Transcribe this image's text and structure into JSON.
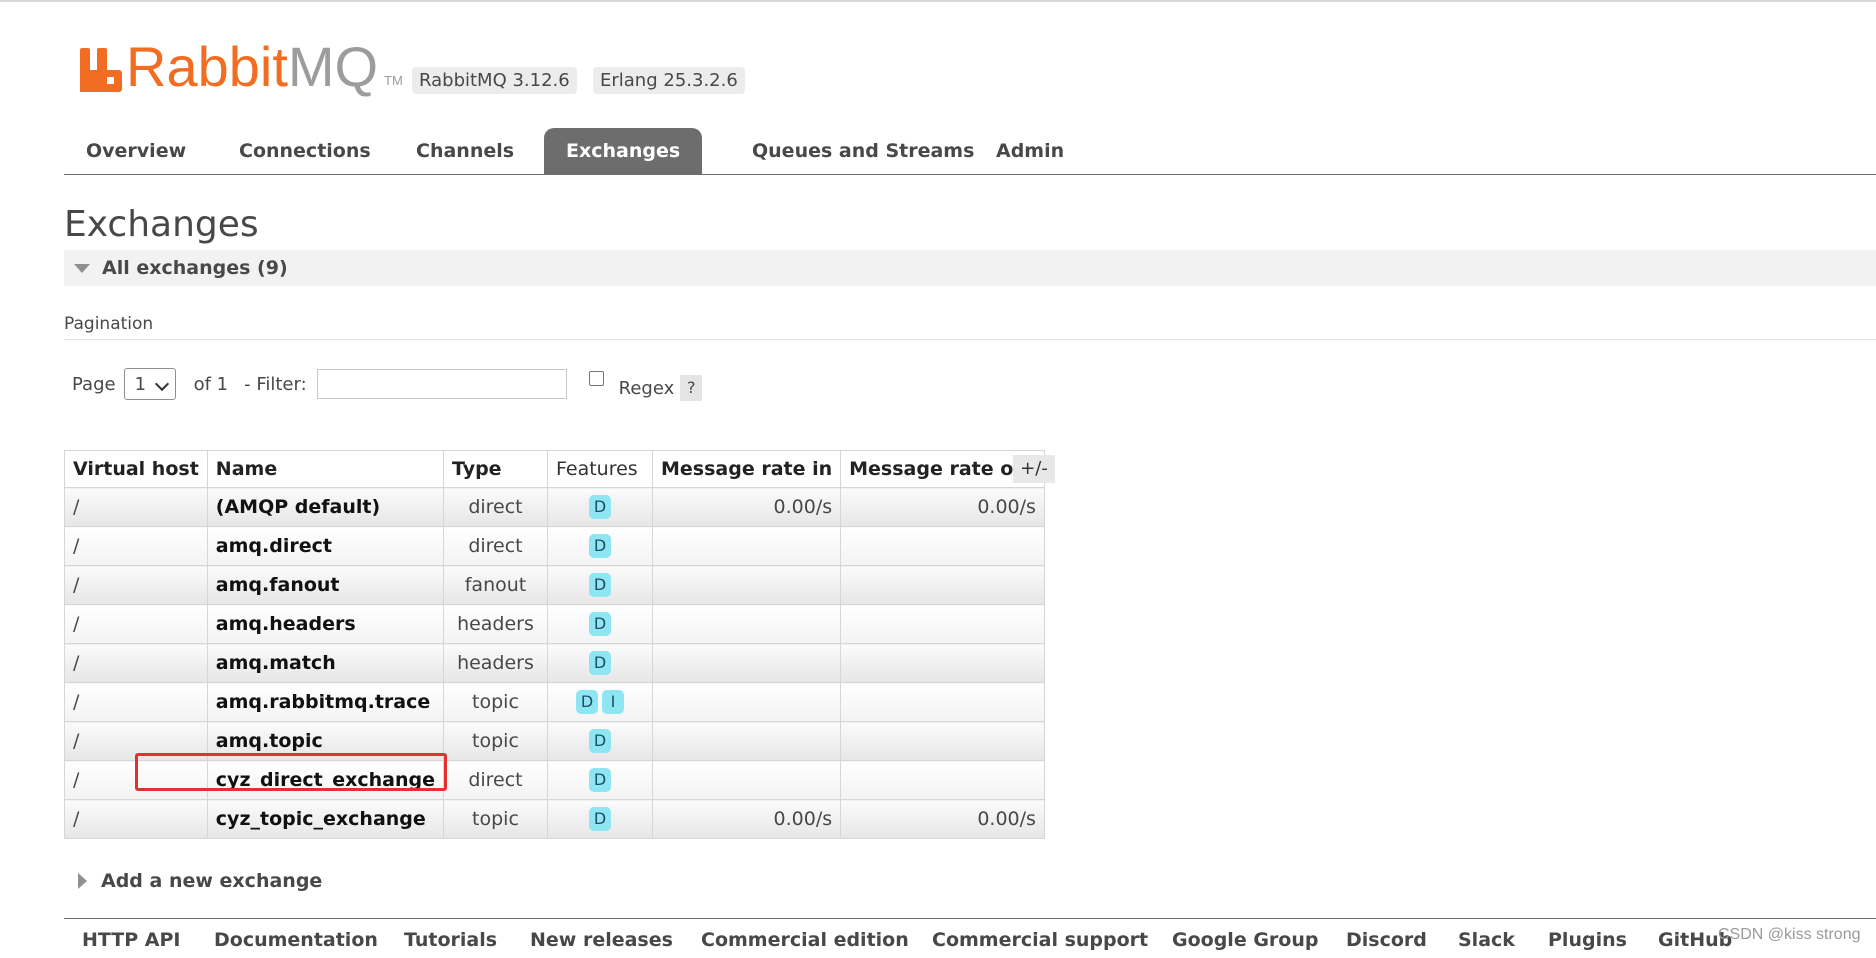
{
  "header": {
    "logo_text_rabbit": "Rabbit",
    "logo_text_mq": "MQ",
    "logo_tm": "TM",
    "rabbitmq_version": "RabbitMQ 3.12.6",
    "erlang_version": "Erlang 25.3.2.6"
  },
  "nav": {
    "tabs": [
      {
        "label": "Overview"
      },
      {
        "label": "Connections"
      },
      {
        "label": "Channels"
      },
      {
        "label": "Exchanges",
        "active": true
      },
      {
        "label": "Queues and Streams"
      },
      {
        "label": "Admin"
      }
    ]
  },
  "page": {
    "title": "Exchanges",
    "section_label": "All exchanges (9)",
    "pagination_label": "Pagination"
  },
  "pager": {
    "page_label": "Page",
    "page_value": "1",
    "of_label": "of 1",
    "filter_label": "- Filter:",
    "filter_value": "",
    "regex_label": "Regex",
    "help_label": "?"
  },
  "table": {
    "headers": [
      "Virtual host",
      "Name",
      "Type",
      "Features",
      "Message rate in",
      "Message rate out"
    ],
    "toggle_columns_label": "+/-",
    "rows": [
      {
        "vhost": "/",
        "name": "(AMQP default)",
        "type": "direct",
        "features": [
          "D"
        ],
        "rate_in": "0.00/s",
        "rate_out": "0.00/s"
      },
      {
        "vhost": "/",
        "name": "amq.direct",
        "type": "direct",
        "features": [
          "D"
        ],
        "rate_in": "",
        "rate_out": ""
      },
      {
        "vhost": "/",
        "name": "amq.fanout",
        "type": "fanout",
        "features": [
          "D"
        ],
        "rate_in": "",
        "rate_out": ""
      },
      {
        "vhost": "/",
        "name": "amq.headers",
        "type": "headers",
        "features": [
          "D"
        ],
        "rate_in": "",
        "rate_out": ""
      },
      {
        "vhost": "/",
        "name": "amq.match",
        "type": "headers",
        "features": [
          "D"
        ],
        "rate_in": "",
        "rate_out": ""
      },
      {
        "vhost": "/",
        "name": "amq.rabbitmq.trace",
        "type": "topic",
        "features": [
          "D",
          "I"
        ],
        "rate_in": "",
        "rate_out": ""
      },
      {
        "vhost": "/",
        "name": "amq.topic",
        "type": "topic",
        "features": [
          "D"
        ],
        "rate_in": "",
        "rate_out": ""
      },
      {
        "vhost": "/",
        "name": "cyz_direct_exchange",
        "type": "direct",
        "features": [
          "D"
        ],
        "rate_in": "",
        "rate_out": ""
      },
      {
        "vhost": "/",
        "name": "cyz_topic_exchange",
        "type": "topic",
        "features": [
          "D"
        ],
        "rate_in": "0.00/s",
        "rate_out": "0.00/s"
      }
    ]
  },
  "add_exchange": {
    "label": "Add a new exchange"
  },
  "footer": {
    "links": [
      "HTTP API",
      "Documentation",
      "Tutorials",
      "New releases",
      "Commercial edition",
      "Commercial support",
      "Google Group",
      "Discord",
      "Slack",
      "Plugins",
      "GitHub"
    ]
  },
  "watermark": "CSDN @kiss strong",
  "colors": {
    "brand_orange": "#f26c22",
    "active_tab": "#6d6d6d",
    "feature_badge": "#8ee6f2",
    "highlight_box": "#e53030"
  }
}
